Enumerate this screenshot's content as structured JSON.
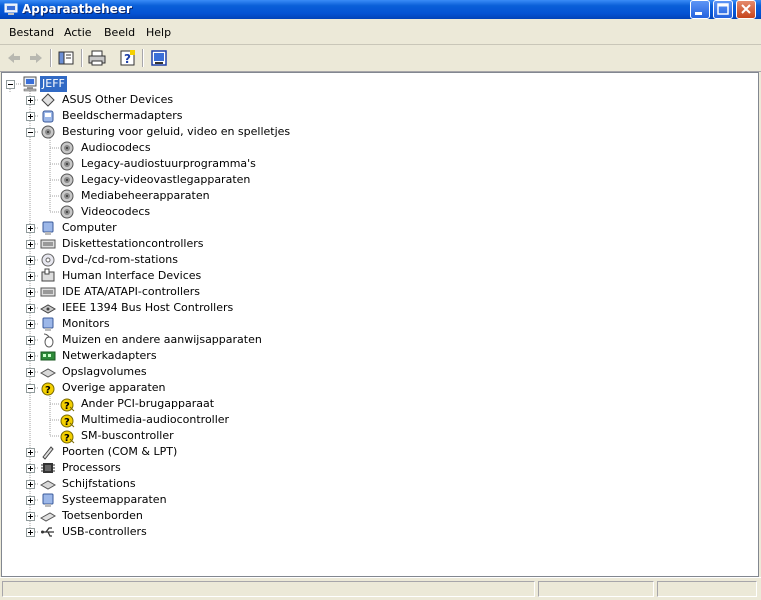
{
  "window": {
    "title": "Apparaatbeheer"
  },
  "menu": [
    "Bestand",
    "Actie",
    "Beeld",
    "Help"
  ],
  "toolbar": {
    "buttons": [
      "back-icon",
      "forward-icon",
      "show-hide-console-tree-icon",
      "print-icon",
      "help-icon",
      "properties-icon"
    ]
  },
  "tree": {
    "root": "JEFF",
    "categories": [
      {
        "label": "ASUS Other Devices",
        "icon": "asus-device-icon",
        "expanded": false,
        "children": []
      },
      {
        "label": "Beeldschermadapters",
        "icon": "display-adapter-icon",
        "expanded": false,
        "children": []
      },
      {
        "label": "Besturing voor geluid, video en spelletjes",
        "icon": "sound-icon",
        "expanded": true,
        "children": [
          "Audiocodecs",
          "Legacy-audiostuurprogramma's",
          "Legacy-videovastlegapparaten",
          "Mediabeheerapparaten",
          "Videocodecs"
        ]
      },
      {
        "label": "Computer",
        "icon": "computer-icon",
        "expanded": false,
        "children": []
      },
      {
        "label": "Diskettestationcontrollers",
        "icon": "floppy-controller-icon",
        "expanded": false,
        "children": []
      },
      {
        "label": "Dvd-/cd-rom-stations",
        "icon": "cdrom-icon",
        "expanded": false,
        "children": []
      },
      {
        "label": "Human Interface Devices",
        "icon": "hid-icon",
        "expanded": false,
        "children": []
      },
      {
        "label": "IDE ATA/ATAPI-controllers",
        "icon": "ide-controller-icon",
        "expanded": false,
        "children": []
      },
      {
        "label": "IEEE 1394 Bus Host Controllers",
        "icon": "firewire-icon",
        "expanded": false,
        "children": []
      },
      {
        "label": "Monitors",
        "icon": "monitor-icon",
        "expanded": false,
        "children": []
      },
      {
        "label": "Muizen en andere aanwijsapparaten",
        "icon": "mouse-icon",
        "expanded": false,
        "children": []
      },
      {
        "label": "Netwerkadapters",
        "icon": "network-adapter-icon",
        "expanded": false,
        "children": []
      },
      {
        "label": "Opslagvolumes",
        "icon": "storage-volume-icon",
        "expanded": false,
        "children": []
      },
      {
        "label": "Overige apparaten",
        "icon": "unknown-device-icon",
        "expanded": true,
        "children": [
          "Ander PCI-brugapparaat",
          "Multimedia-audiocontroller",
          "SM-buscontroller"
        ]
      },
      {
        "label": "Poorten (COM & LPT)",
        "icon": "port-icon",
        "expanded": false,
        "children": []
      },
      {
        "label": "Processors",
        "icon": "processor-icon",
        "expanded": false,
        "children": []
      },
      {
        "label": "Schijfstations",
        "icon": "disk-drive-icon",
        "expanded": false,
        "children": []
      },
      {
        "label": "Systeemapparaten",
        "icon": "system-device-icon",
        "expanded": false,
        "children": []
      },
      {
        "label": "Toetsenborden",
        "icon": "keyboard-icon",
        "expanded": false,
        "children": []
      },
      {
        "label": "USB-controllers",
        "icon": "usb-icon",
        "expanded": false,
        "children": []
      }
    ]
  },
  "colors": {
    "selection": "#316ac5",
    "titlebar": "#0453d4",
    "chrome": "#ece9d8"
  }
}
